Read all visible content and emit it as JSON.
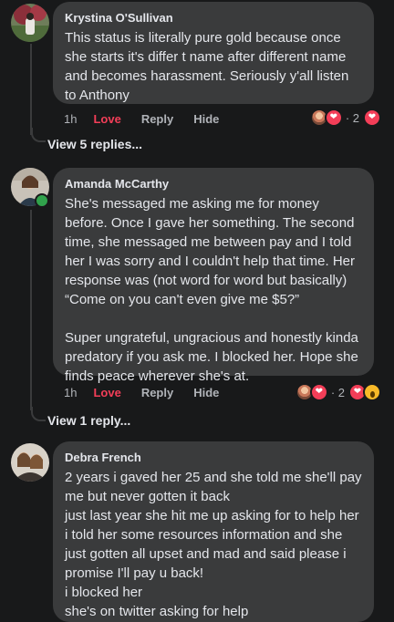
{
  "comments": [
    {
      "author": "Krystina O'Sullivan",
      "text": "This status is literally pure gold because once she starts it's differ t name after different name and becomes harassment. Seriously y'all listen to Anthony",
      "time": "1h",
      "love_label": "Love",
      "reply_label": "Reply",
      "hide_label": "Hide",
      "reaction_count": "2",
      "view_replies": "View 5 replies..."
    },
    {
      "author": "Amanda McCarthy",
      "text": "She's messaged me asking me for money before. Once I gave her something. The second time, she messaged me between pay and I told her I was sorry and I couldn't help that time. Her response was (not word for word but basically) “Come on you can't even give me $5?”\n\nSuper ungrateful, ungracious and honestly kinda predatory if you ask me. I blocked her. Hope she finds peace wherever she's at.",
      "time": "1h",
      "love_label": "Love",
      "reply_label": "Reply",
      "hide_label": "Hide",
      "reaction_count": "2",
      "view_replies": "View 1 reply..."
    },
    {
      "author": "Debra French",
      "text": "2 years i gaved her 25 and she told me she'll pay me but never gotten it back\njust last year she hit me up asking for to help her i told her some resources information and she just gotten all upset and mad and said please i promise I'll pay u back!\ni blocked her\nshe's on twitter asking for help"
    }
  ],
  "colors": {
    "background": "#18191a",
    "bubble": "#3a3b3c",
    "love": "#f33e58",
    "online": "#31a24c"
  }
}
